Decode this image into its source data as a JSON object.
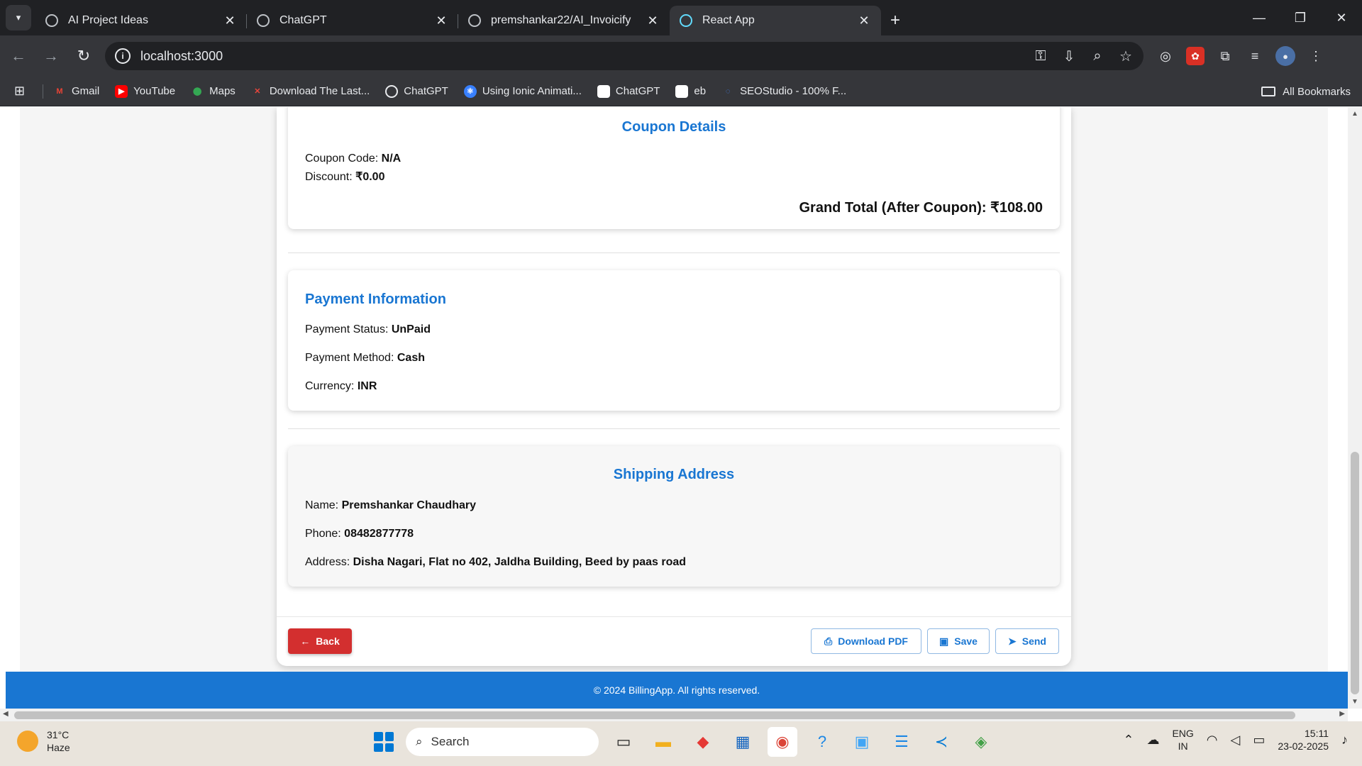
{
  "browser": {
    "tabs": [
      {
        "title": "AI Project Ideas",
        "active": false
      },
      {
        "title": "ChatGPT",
        "active": false
      },
      {
        "title": "premshankar22/AI_Invoicify",
        "active": false
      },
      {
        "title": "React App",
        "active": true
      }
    ],
    "url": "localhost:3000",
    "bookmarks": [
      "Gmail",
      "YouTube",
      "Maps",
      "Download The Last...",
      "ChatGPT",
      "Using Ionic Animati...",
      "ChatGPT",
      "eb",
      "SEOStudio - 100% F..."
    ],
    "all_bookmarks": "All Bookmarks"
  },
  "coupon": {
    "title": "Coupon Details",
    "code_label": "Coupon Code:",
    "code_value": "N/A",
    "discount_label": "Discount:",
    "discount_value": "₹0.00",
    "grand_total": "Grand Total (After Coupon): ₹108.00"
  },
  "payment": {
    "title": "Payment Information",
    "status_label": "Payment Status:",
    "status_value": "UnPaid",
    "method_label": "Payment Method:",
    "method_value": "Cash",
    "currency_label": "Currency:",
    "currency_value": "INR"
  },
  "shipping": {
    "title": "Shipping Address",
    "name_label": "Name:",
    "name_value": "Premshankar Chaudhary",
    "phone_label": "Phone:",
    "phone_value": "08482877778",
    "address_label": "Address:",
    "address_value": "Disha Nagari, Flat no 402, Jaldha Building, Beed by paas road"
  },
  "actions": {
    "back": "Back",
    "download": "Download PDF",
    "save": "Save",
    "send": "Send"
  },
  "footer": "© 2024 BillingApp. All rights reserved.",
  "taskbar": {
    "temp": "31°C",
    "weather": "Haze",
    "search_placeholder": "Search",
    "lang1": "ENG",
    "lang2": "IN",
    "time": "15:11",
    "date": "23-02-2025"
  },
  "colors": {
    "accent": "#1976d2",
    "danger": "#d32f2f"
  }
}
